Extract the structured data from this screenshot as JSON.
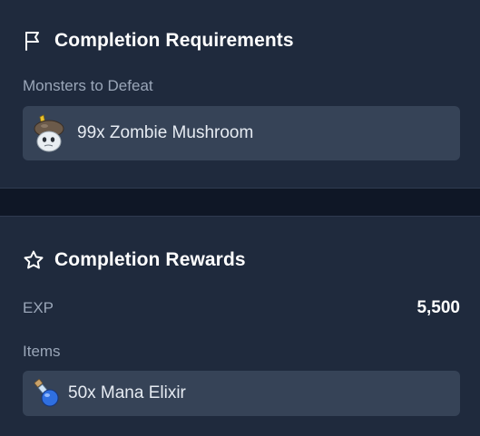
{
  "requirements": {
    "title": "Completion Requirements",
    "title_icon": "flag-icon",
    "monsters_label": "Monsters to Defeat",
    "monster": {
      "text": "99x Zombie Mushroom",
      "icon": "zombie-mushroom-icon"
    }
  },
  "rewards": {
    "title": "Completion Rewards",
    "title_icon": "star-icon",
    "exp_label": "EXP",
    "exp_value": "5,500",
    "items_label": "Items",
    "item": {
      "text": "50x Mana Elixir",
      "icon": "mana-elixir-icon"
    }
  },
  "colors": {
    "panel": "#1f2a3d",
    "card": "#364357",
    "gap": "#0f1726",
    "muted_text": "#9aa6b8"
  }
}
